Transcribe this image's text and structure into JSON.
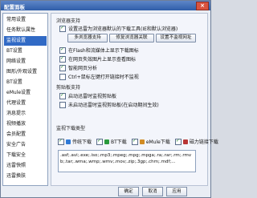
{
  "window": {
    "title": "配置面板",
    "close_symbol": "×"
  },
  "sidebar": {
    "items": [
      {
        "label": "常用设置"
      },
      {
        "label": "任务默认属性"
      },
      {
        "label": "监视设置",
        "active": true
      },
      {
        "label": "BT设置"
      },
      {
        "label": "网络设置"
      },
      {
        "label": "图形/外观设置"
      },
      {
        "label": "BT设置"
      },
      {
        "label": "eMule设置"
      },
      {
        "label": "代理设置"
      },
      {
        "label": "消息提示"
      },
      {
        "label": "视频播放"
      },
      {
        "label": "会员配置"
      },
      {
        "label": "安全广告"
      },
      {
        "label": "下载安全"
      },
      {
        "label": "迅雷快照"
      },
      {
        "label": "迅雷换肤"
      }
    ]
  },
  "content": {
    "browser_section_title": "浏览器支持",
    "chk_browser_monitor": "设置迅雷为浏览器默认的下载工具(IE和默认浏览器)",
    "btn_multi_browser": "多浏览器支持",
    "btn_repair_browser": "修复浏览器关联",
    "btn_default_url": "设置不监视网址",
    "chk_flash": "在Flash和流媒体上显示下载图标",
    "chk_page_video": "在网页失效图片上显示查看图标",
    "chk_smart_analysis": "智能网页分析",
    "chk_ctrl_click": "Ctrl+鼠标左键打开链接时不监视",
    "clipboard_section_title": "剪贴板支持",
    "chk_clip_1": "启动迅雷时监视剪贴板",
    "chk_clip_2": "未启动迅雷时监视剪贴板(在启动期间生效)",
    "types_section_title": "监视下载类型",
    "types": [
      {
        "label": "传统下载",
        "color": "#2f7ad6"
      },
      {
        "label": "BT下载",
        "color": "#2a9a3c"
      },
      {
        "label": "eMule下载",
        "color": "#d18b23"
      },
      {
        "label": "磁力链接下载",
        "color": "#b83535"
      }
    ],
    "extensions_text": ".asf;.avi;.exe;.iso;.mp3;.mpeg;.mpg;.mpga;.ra;.rar;.rm;.rmvb;.tar;.wma;.wmp;.wmv;.mov;.zip;.3gp;.chm;.mdf;..."
  },
  "footer": {
    "ok": "确定",
    "cancel": "取消",
    "apply": "应用"
  }
}
